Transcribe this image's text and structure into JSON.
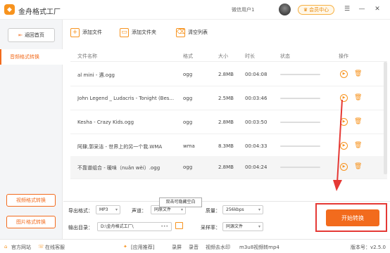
{
  "app": {
    "title": "金舟格式工厂",
    "user": "微信用户1",
    "vip": "会员中心"
  },
  "sidebar": {
    "back": "返回首页",
    "active": "音频格式转换",
    "video": "视频格式转换",
    "image": "图片格式转换"
  },
  "toolbar": {
    "add_file": "添加文件",
    "add_folder": "添加文件夹",
    "clear": "清空列表"
  },
  "table": {
    "headers": [
      "文件名称",
      "格式",
      "大小",
      "时长",
      "状态",
      "操作"
    ],
    "rows": [
      {
        "name": "al mini - 遇.ogg",
        "format": "ogg",
        "size": "2.8MB",
        "duration": "00:04:08"
      },
      {
        "name": "John Legend _ Ludacris - Tonight (Bes...",
        "format": "ogg",
        "size": "2.5MB",
        "duration": "00:03:46"
      },
      {
        "name": "Kesha - Crazy Kids.ogg",
        "format": "ogg",
        "size": "2.8MB",
        "duration": "00:03:50"
      },
      {
        "name": "阿肆,郭采洁 - 世界上的另一个我.WMA",
        "format": "wma",
        "size": "8.3MB",
        "duration": "00:04:33"
      },
      {
        "name": "不靠谱组合 - 暖味（nuǎn wèi）.ogg",
        "format": "ogg",
        "size": "2.8MB",
        "duration": "00:04:24"
      }
    ]
  },
  "tooltip": "双击可隐藏空白",
  "settings": {
    "format_label": "导出格式：",
    "format_value": "MP3",
    "channel_label": "声道：",
    "channel_value": "同原文件",
    "quality_label": "质量：",
    "quality_value": "256kbps",
    "dir_label": "输出目录：",
    "dir_value": "D:\\金舟格式工厂\\",
    "dir_more": "•••",
    "samplerate_label": "采样率：",
    "samplerate_value": "同源文件"
  },
  "start": "开始转换",
  "status": {
    "site": "官方网站",
    "service": "在线客服",
    "recommend": "[应用推荐]",
    "screen": "录屏",
    "record": "录音",
    "watermark": "视频去水印",
    "m3u8": "m3u8视频转mp4",
    "version": "版本号：v2.5.0"
  }
}
